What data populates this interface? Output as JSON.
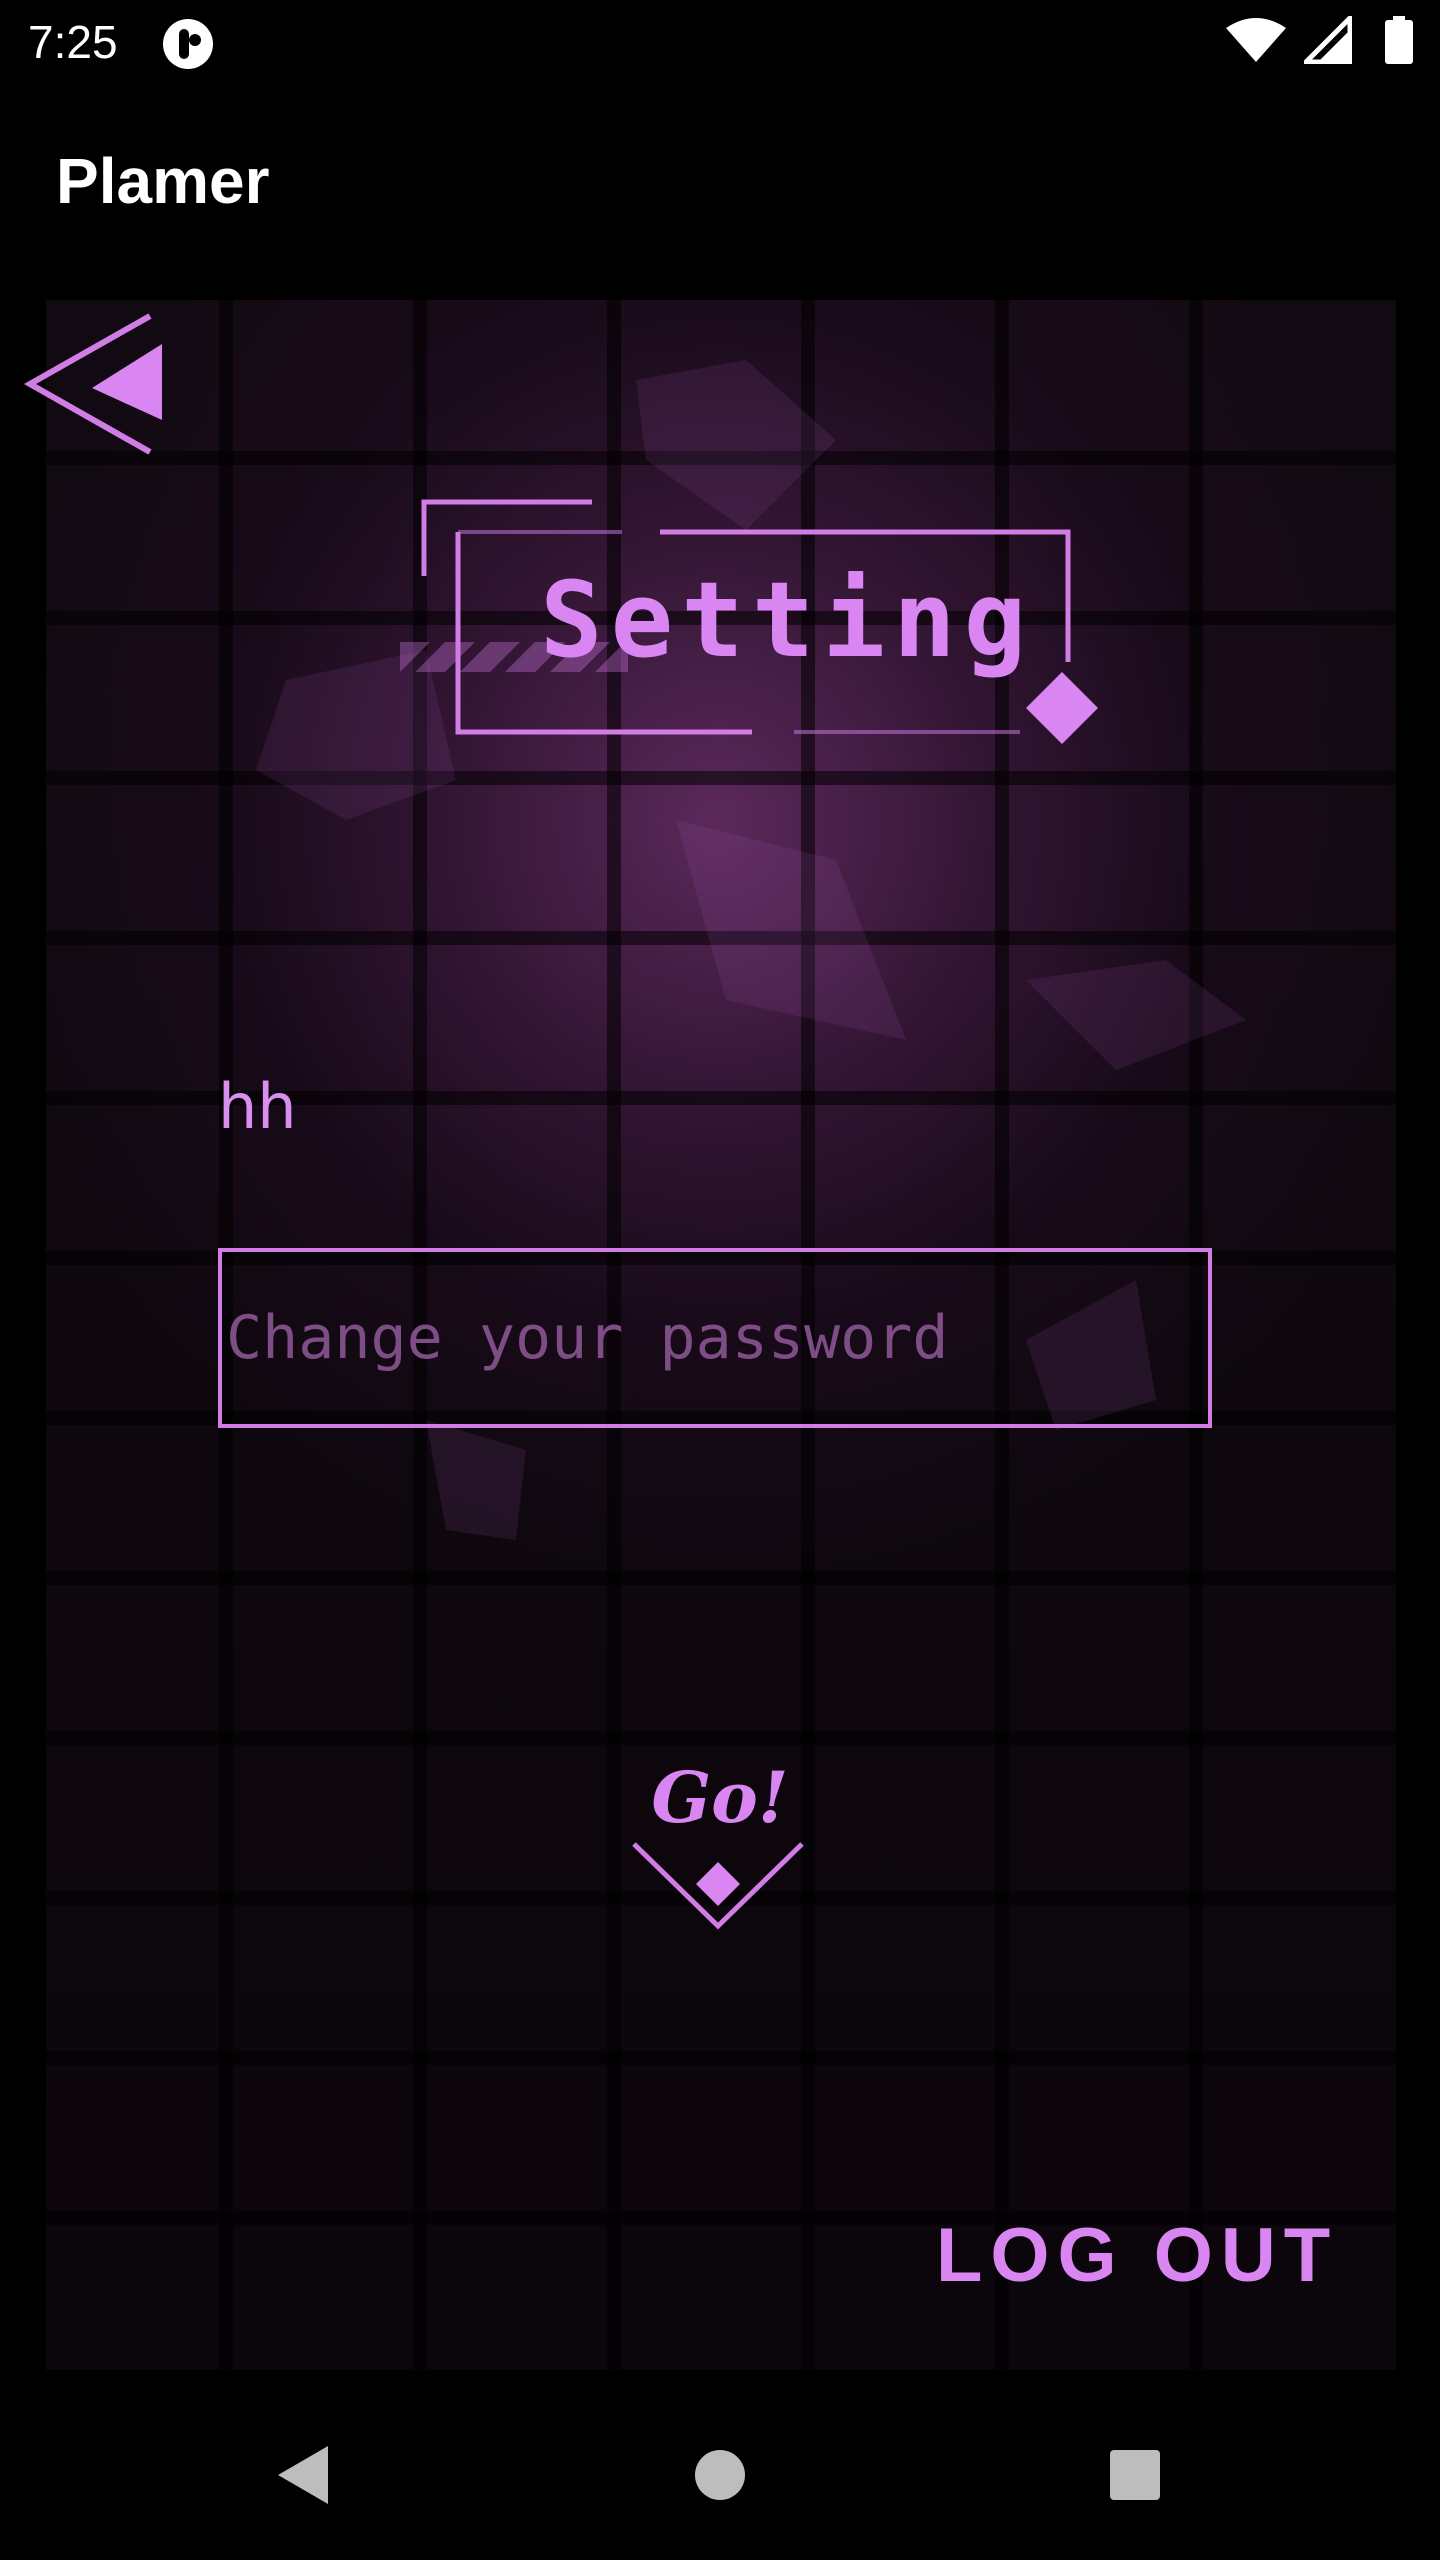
{
  "status_bar": {
    "time": "7:25",
    "icons": [
      "app-notification-icon",
      "wifi-icon",
      "signal-icon",
      "battery-icon"
    ]
  },
  "app_bar": {
    "title": "Plamer"
  },
  "screen": {
    "back_icon": "back-arrow-icon",
    "title": "Setting",
    "username": "hh",
    "password": {
      "value": "",
      "placeholder": "Change your password"
    },
    "go_label": "Go!",
    "logout_label": "LOG OUT"
  },
  "nav_bar": {
    "buttons": [
      "back-nav-icon",
      "home-nav-icon",
      "recents-nav-icon"
    ]
  },
  "colors": {
    "accent": "#d986f2",
    "placeholder": "#7e4d86",
    "background": "#000000"
  }
}
